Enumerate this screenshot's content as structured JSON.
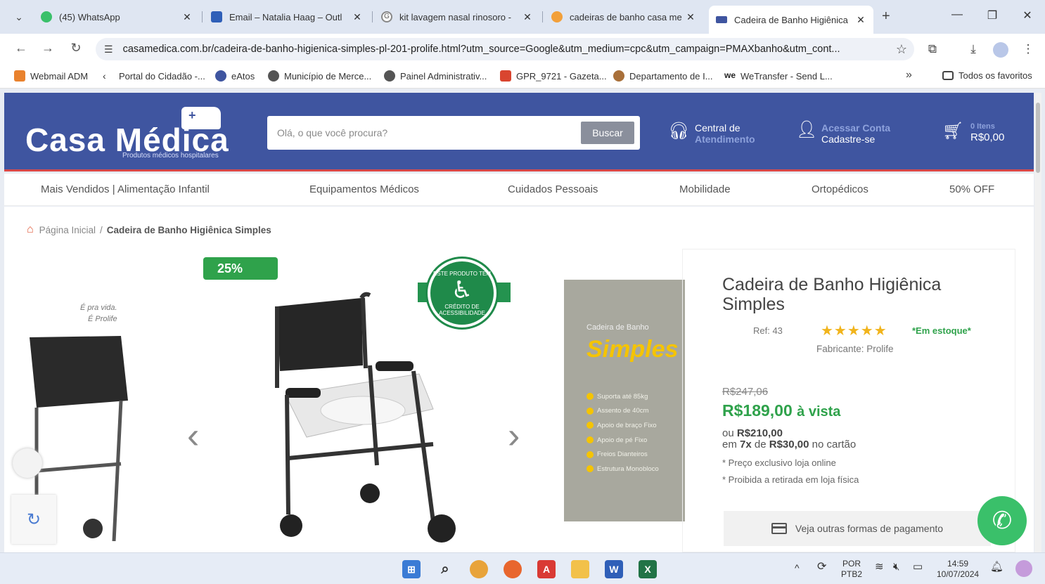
{
  "browser": {
    "tabs": [
      {
        "title": "(45) WhatsApp",
        "color": "#3ac06a"
      },
      {
        "title": "Email – Natalia Haag – Outl",
        "color": "#2f5fb8"
      },
      {
        "title": "kit lavagem nasal rinosoro -",
        "color": "#ffffff"
      },
      {
        "title": "cadeiras de banho casa me",
        "color": "#f2a03a"
      },
      {
        "title": "Cadeira de Banho Higiênica",
        "color": "#3f55a0"
      }
    ],
    "url": "casamedica.com.br/cadeira-de-banho-higienica-simples-pl-201-prolife.html?utm_source=Google&utm_medium=cpc&utm_campaign=PMAXbanho&utm_cont...",
    "bookmarks": [
      "Webmail ADM",
      "Portal do Cidadão -...",
      "eAtos",
      "Município de Merce...",
      "Painel Administrativ...",
      "GPR_9721 - Gazeta...",
      "Departamento de I...",
      "WeTransfer - Send L..."
    ],
    "all_bookmarks": "Todos os favoritos"
  },
  "site": {
    "logo": "Casa Médica",
    "logo_sub": "Produtos médicos hospitalares",
    "search_placeholder": "Olá, o que você procura?",
    "search_button": "Buscar",
    "support_line1": "Central de",
    "support_line2": "Atendimento",
    "account_line1": "Acessar Conta",
    "account_line2": "Cadastre-se",
    "cart_items": "0 Itens",
    "cart_total": "R$0,00",
    "categories": [
      "Mais Vendidos | Alimentação Infantil",
      "Equipamentos Médicos",
      "Cuidados Pessoais",
      "Mobilidade",
      "Ortopédicos",
      "50% OFF"
    ]
  },
  "breadcrumb": {
    "home": "Página Inicial",
    "sep": "/",
    "current": "Cadeira de Banho Higiênica Simples"
  },
  "gallery": {
    "discount": "25%",
    "tagline_1": "É pra vida.",
    "tagline_2": "É Prolife",
    "seal_top": "ESTE PRODUTO TEM",
    "seal_bottom": "CRÉDITO DE ACESSIBILIDADE",
    "promo_small": "Cadeira de Banho",
    "promo_big": "Simples",
    "promo_features": [
      "Suporta até 85kg",
      "Assento de 40cm",
      "Apoio de braço Fixo",
      "Apoio de pé Fixo",
      "Freios Dianteiros",
      "Estrutura Monobloco"
    ]
  },
  "product": {
    "title": "Cadeira de Banho Higiênica Simples",
    "ref": "Ref: 43",
    "rating": 5,
    "stock": "*Em estoque*",
    "maker": "Fabricante: Prolife",
    "old_price": "R$247,06",
    "price": "R$189,00",
    "price_suffix": "à vista",
    "card_line1_prefix": "ou",
    "card_total": "R$210,00",
    "card_line2_prefix": "em",
    "installments": "7x",
    "card_line2_mid": "de",
    "installment_value": "R$30,00",
    "card_line2_suffix": "no cartão",
    "note1": "* Preço exclusivo loja online",
    "note2": "* Proibida a retirada em loja física",
    "payment_button": "Veja outras formas de pagamento"
  },
  "taskbar": {
    "lang_1": "POR",
    "lang_2": "PTB2",
    "time": "14:59",
    "date": "10/07/2024"
  },
  "colors": {
    "brand_blue": "#3f55a0",
    "price_green": "#2fa24b",
    "star_yellow": "#f1b41c",
    "header_red_line": "#d94848"
  }
}
